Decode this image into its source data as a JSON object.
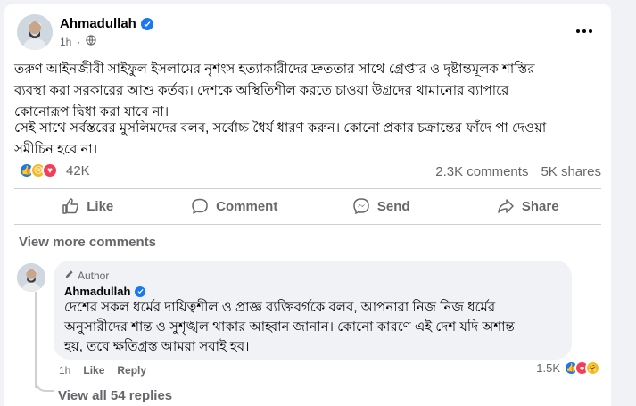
{
  "post": {
    "author": "Ahmadullah",
    "time": "1h",
    "paragraph1": "তরুণ আইনজীবী সাইফুল ইসলামের নৃশংস হত্যাকারীদের দ্রুততার সাথে গ্রেপ্তার ও দৃষ্টান্তমূলক শাস্তির\nব্যবস্থা করা সরকারের আশু কর্তব্য। দেশকে অস্থিতিশীল করতে চাওয়া উগ্রদের থামানোর ব্যাপারে\nকোনোরূপ দ্বিধা করা যাবে না।",
    "paragraph2": "সেই সাথে সর্বস্তরের মুসলিমদের বলব, সর্বোচ্চ ধৈর্য ধারণ করুন। কোনো প্রকার চক্রান্তের ফাঁদে পা দেওয়া\nসমীচিন হবে না।"
  },
  "reactions": {
    "count": "42K",
    "comments": "2.3K comments",
    "shares": "5K shares"
  },
  "actions": {
    "like": "Like",
    "comment": "Comment",
    "send": "Send",
    "share": "Share"
  },
  "comments": {
    "view_more": "View more comments",
    "author_badge": "Author",
    "name": "Ahmadullah",
    "text": "দেশের সকল ধর্মের দায়িত্বশীল ও প্রাজ্ঞ ব্যক্তিবর্গকে বলব, আপনারা নিজ নিজ ধর্মের\nঅনুসারীদের শান্ত ও সুশৃঙ্খল থাকার আহ্বান জানান। কোনো কারণে এই দেশ যদি অশান্ত\nহয়, তবে ক্ষতিগ্রস্ত আমরা সবাই হব।",
    "time": "1h",
    "like": "Like",
    "reply": "Reply",
    "reaction_count": "1.5K",
    "view_all": "View all 54 replies"
  },
  "colors": {
    "accent": "#1877f2",
    "muted": "#65676b",
    "background": "#f0f2f5"
  }
}
